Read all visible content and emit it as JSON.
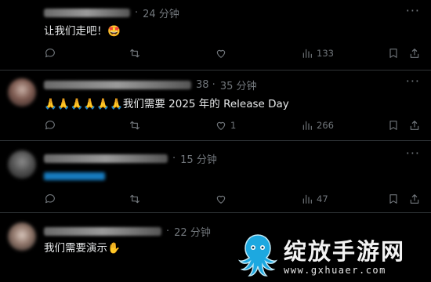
{
  "posts": [
    {
      "time": "24 分钟",
      "time_prefix": "·",
      "text": "让我们走吧！🤩",
      "actions": {
        "reply": "",
        "retweet": "",
        "like": "",
        "views": "133"
      }
    },
    {
      "time": "35 分钟",
      "time_prefix": "38 ·",
      "text": "🙏🙏🙏🙏🙏🙏我们需要 2025 年的 Release Day",
      "actions": {
        "reply": "",
        "retweet": "",
        "like": "1",
        "views": "266"
      }
    },
    {
      "time": "15 分钟",
      "time_prefix": "·",
      "text": "",
      "actions": {
        "reply": "",
        "retweet": "",
        "like": "",
        "views": "47"
      }
    },
    {
      "time": "22 分钟",
      "time_prefix": "·",
      "text": "我们需要演示✋",
      "actions": {}
    }
  ],
  "more_label": "···",
  "watermark": {
    "title": "绽放手游网",
    "url": "www.gxhuaer.com"
  },
  "colors": {
    "background": "#000000",
    "text": "#e7e9ea",
    "muted": "#71767b",
    "link": "#1d9bf0",
    "divider": "#2f3336"
  }
}
